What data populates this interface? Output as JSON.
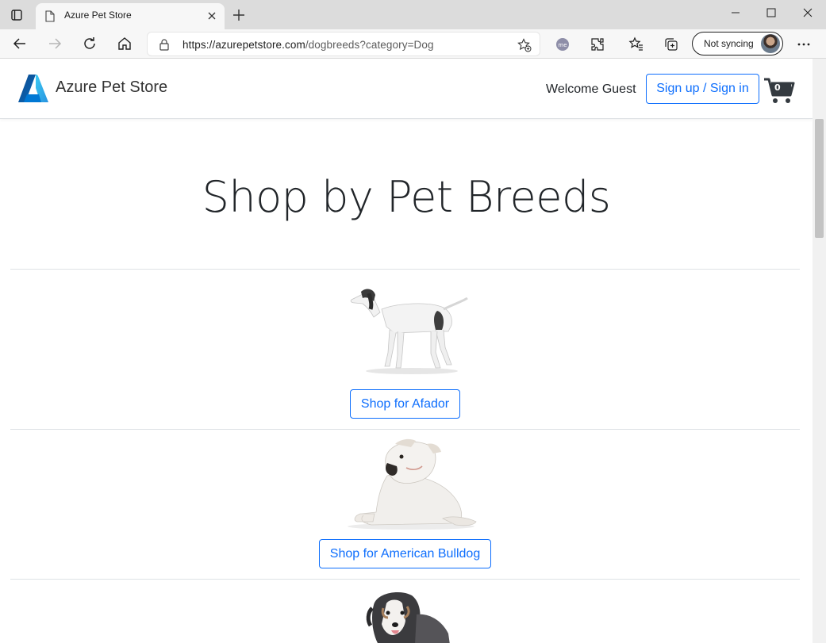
{
  "browser": {
    "tab_title": "Azure Pet Store",
    "url_host": "https://azurepetstore.com",
    "url_path": "/dogbreeds?category=Dog",
    "sync_label": "Not syncing",
    "profile_badge": "me"
  },
  "header": {
    "brand": "Azure Pet Store",
    "welcome": "Welcome Guest",
    "signin_label": "Sign up / Sign in",
    "cart_count": "0"
  },
  "page": {
    "heading": "Shop by Pet Breeds",
    "breeds": [
      {
        "button": "Shop for Afador",
        "image": "pointer-dog-photo"
      },
      {
        "button": "Shop for American Bulldog",
        "image": "bulldog-photo"
      },
      {
        "button": "",
        "image": "australian-shepherd-photo"
      }
    ]
  },
  "colors": {
    "accent": "#0d6efd",
    "chrome_bg": "#dcdcdc",
    "toolbar_bg": "#f7f7f7"
  }
}
